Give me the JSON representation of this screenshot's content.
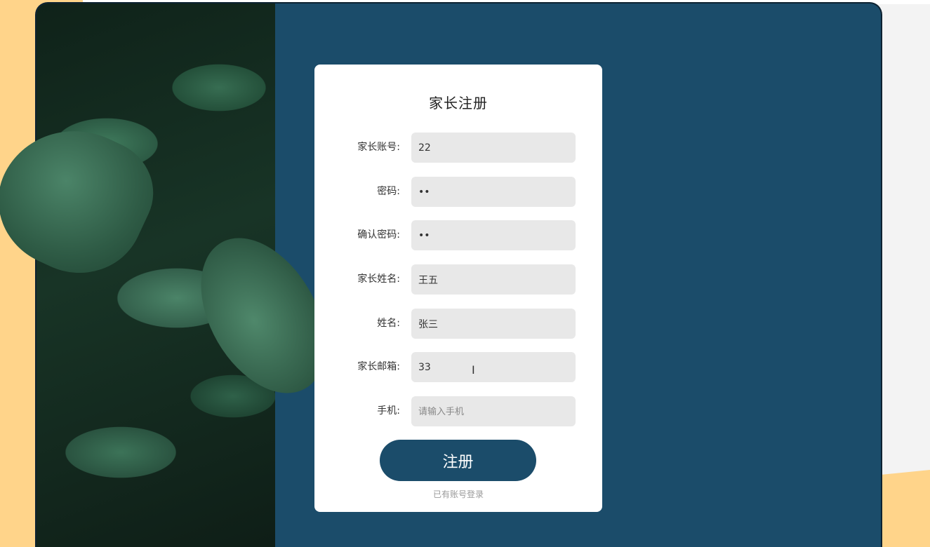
{
  "form": {
    "title": "家长注册",
    "submit_label": "注册",
    "login_link": "已有账号登录",
    "fields": [
      {
        "label": "家长账号:",
        "value": "22",
        "placeholder": "",
        "type": "text"
      },
      {
        "label": "密码:",
        "value": "••",
        "placeholder": "",
        "type": "password"
      },
      {
        "label": "确认密码:",
        "value": "••",
        "placeholder": "",
        "type": "password"
      },
      {
        "label": "家长姓名:",
        "value": "王五",
        "placeholder": "",
        "type": "text"
      },
      {
        "label": "姓名:",
        "value": "张三",
        "placeholder": "",
        "type": "text"
      },
      {
        "label": "家长邮箱:",
        "value": "33",
        "placeholder": "",
        "type": "text"
      },
      {
        "label": "手机:",
        "value": "",
        "placeholder": "请输入手机",
        "type": "text"
      }
    ]
  },
  "colors": {
    "primary": "#1b4c6a",
    "accent_yellow": "#ffd48a",
    "input_bg": "#e8e8e8",
    "card_bg": "#ffffff"
  },
  "icons": {
    "cursor": "text-cursor-icon"
  }
}
